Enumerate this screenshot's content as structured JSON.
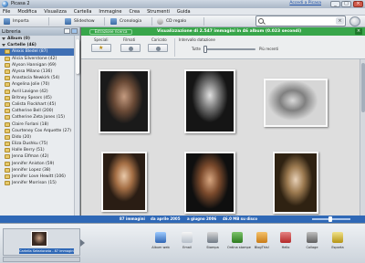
{
  "window": {
    "title": "Picasa 2",
    "user_link": "Accedi a Picasa",
    "controls": [
      "_",
      "□",
      "×"
    ]
  },
  "menu": [
    "File",
    "Modifica",
    "Visualizza",
    "Cartella",
    "Immagine",
    "Crea",
    "Strumenti",
    "Guida"
  ],
  "toolbar": {
    "import_label": "Importa",
    "slideshow_label": "Slideshow",
    "timeline_label": "Cronologia",
    "cd_label": "CD regalo",
    "search_value": "",
    "search_clear": "×"
  },
  "library": {
    "title": "Libreria",
    "groups": [
      {
        "label": "Album (0)",
        "items": []
      },
      {
        "label": "Cartelle (46)",
        "items": [
          "Alexis Bledel (87)",
          "Alicia Silverstone (42)",
          "Alyson Hannigan (69)",
          "Alyssa Milano (136)",
          "Anastacia Newkirk (54)",
          "Angelina Jolie (70)",
          "Avril Lavigne (42)",
          "Britney Spears (45)",
          "Calista Flockhart (45)",
          "Catherine Bell (200)",
          "Catherine Zeta Jones (15)",
          "Claire Forlani (18)",
          "Courteney Cox Arquette (27)",
          "Dido (20)",
          "Eliza Dushku (75)",
          "Halle Berry (51)",
          "Jenna Elfman (42)",
          "Jennifer Aniston (59)",
          "Jennifer Lopez (38)",
          "Jennifer Love Hewitt (106)",
          "Jennifer Morrison (15)"
        ]
      }
    ],
    "selected": "Alexis Bledel (87)"
  },
  "filter": {
    "tab_label": "Estrazione ricerca",
    "info": "Visualizzazione di 2.547 immagini in 46 album (0.023 secondi)",
    "close": "×",
    "col_special": "Speciali",
    "col_movies": "Filmati",
    "col_uploaded": "Caricato",
    "col_date_range": "Intervallo datazione",
    "slider_left": "Tutte",
    "slider_right": "Più recenti",
    "slider_position": 0
  },
  "grid": {
    "thumbnails": [
      {
        "icon": "portrait-photo-icon"
      },
      {
        "icon": "portrait-photo-icon"
      },
      {
        "icon": "portrait-photo-icon"
      },
      {
        "icon": "portrait-photo-icon"
      },
      {
        "icon": "portrait-photo-icon"
      },
      {
        "icon": "portrait-photo-icon"
      }
    ]
  },
  "status": {
    "count": "87 immagini",
    "from": "da aprile 2005",
    "to": "a giugno 2006",
    "size": "46.0 MB su disco"
  },
  "tray": {
    "label": "Cartella Selezionata - 87 immagini"
  },
  "actions": [
    "Album web",
    "Email",
    "Stampa",
    "Ordina stampe",
    "BlogThis!",
    "Hello",
    "Collage",
    "Esporta"
  ],
  "colors": {
    "accent_green": "#38a64a",
    "status_blue": "#2f68b6",
    "selection_blue": "#3f6fb4"
  }
}
